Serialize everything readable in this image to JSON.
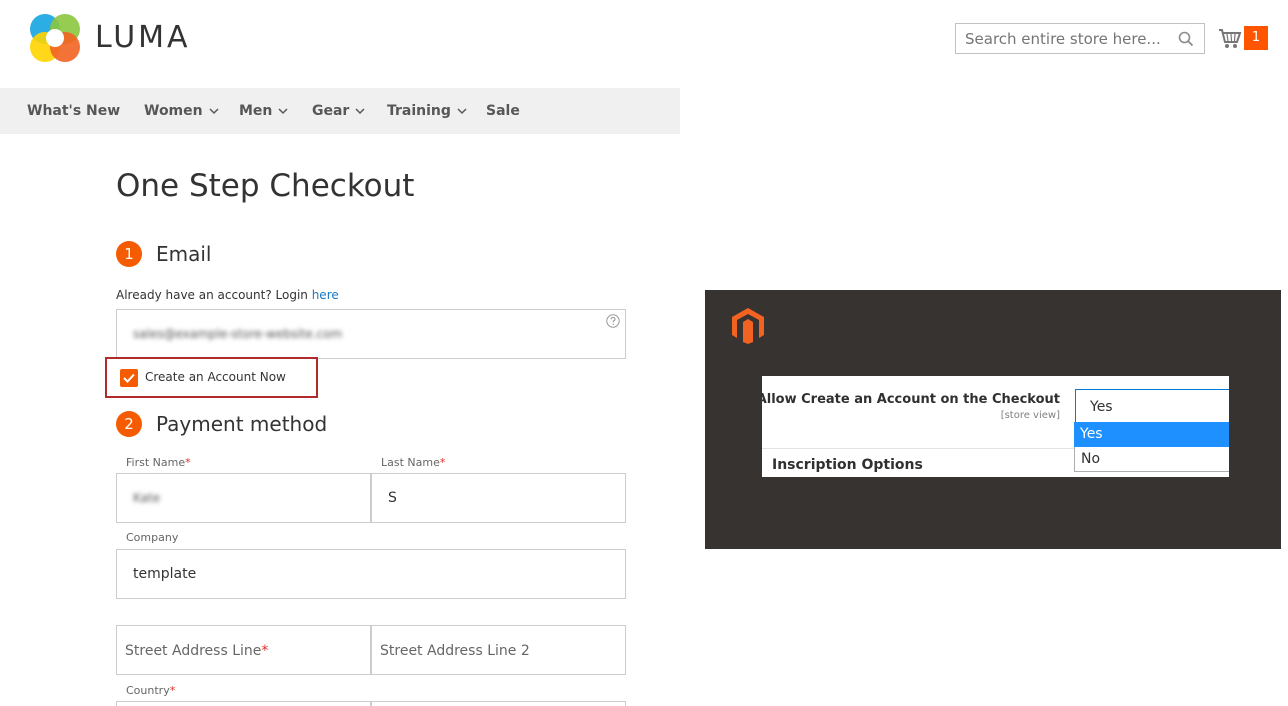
{
  "header": {
    "logo_text": "LUMA",
    "search_placeholder": "Search entire store here...",
    "cart_count": "1"
  },
  "nav": {
    "items": [
      {
        "label": "What's New",
        "dropdown": false
      },
      {
        "label": "Women",
        "dropdown": true
      },
      {
        "label": "Men",
        "dropdown": true
      },
      {
        "label": "Gear",
        "dropdown": true
      },
      {
        "label": "Training",
        "dropdown": true
      },
      {
        "label": "Sale",
        "dropdown": false
      }
    ]
  },
  "checkout": {
    "title": "One Step Checkout",
    "steps": [
      {
        "number": "1",
        "title": "Email"
      },
      {
        "number": "2",
        "title": "Payment method"
      }
    ],
    "login_prompt": "Already have an account? Login ",
    "login_link": "here",
    "email_value": "sales@example-store-website.com",
    "create_account_label": "Create an Account Now",
    "create_account_checked": true,
    "fields": {
      "first_name_label": "First Name",
      "first_name_value": "Kate",
      "last_name_label": "Last Name",
      "last_name_value": "S",
      "company_label": "Company",
      "company_value": "template",
      "street1_placeholder": "Street Address Line",
      "street2_placeholder": "Street Address Line 2",
      "country_label": "Country",
      "required_mark": "*"
    }
  },
  "admin": {
    "setting_label": "Allow Create an Account on the Checkout",
    "scope": "[store view]",
    "selected": "Yes",
    "options": [
      "Yes",
      "No"
    ],
    "next_section": "Inscription Options"
  },
  "colors": {
    "accent": "#f55b00",
    "link": "#1979c3",
    "highlight_border": "#b22b2b",
    "admin_bg": "#373330",
    "option_selected": "#1e90ff"
  }
}
